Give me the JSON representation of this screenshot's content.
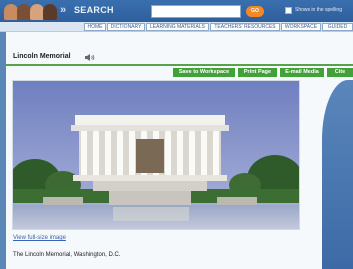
{
  "topbar": {
    "search_label": "SEARCH",
    "search_arrows": "»",
    "search_placeholder": "",
    "go_label": "GO",
    "shows_label": "Shows in the spelling"
  },
  "nav": {
    "items": [
      "HOME",
      "DICTIONARY",
      "LEARNING MATERIALS",
      "TEACHERS' RESOURCES",
      "WORKSPACE",
      "GUIDED"
    ]
  },
  "page": {
    "title": "Lincoln Memorial",
    "actions": [
      "Save to Workspace",
      "Print Page",
      "E-mail Media",
      "Cite"
    ],
    "view_link": "View full-size image",
    "caption": "The Lincoln Memorial, Washington, D.C."
  },
  "icons": {
    "audio": "speaker-icon"
  },
  "colors": {
    "accent_green": "#43a13a",
    "brand_blue": "#3a6fae",
    "go_orange": "#f08a28"
  }
}
